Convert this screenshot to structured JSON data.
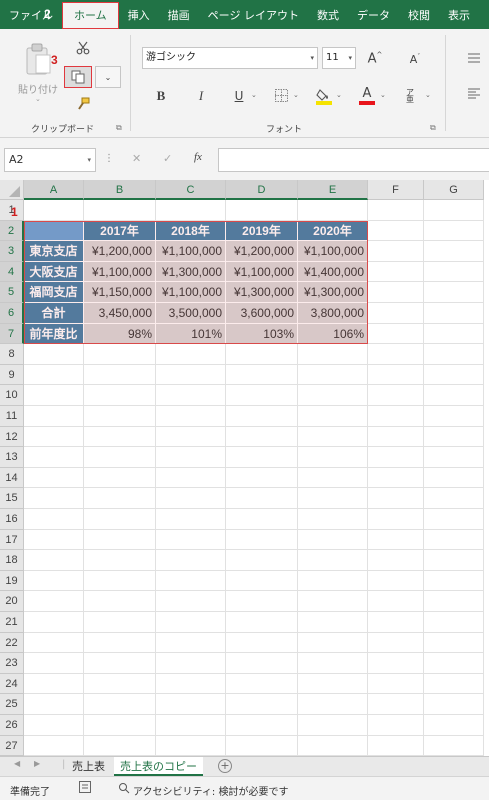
{
  "ribbon_tabs": [
    "ファイル",
    "ホーム",
    "挿入",
    "描画",
    "ページ レイアウト",
    "数式",
    "データ",
    "校閲",
    "表示"
  ],
  "clipboard": {
    "paste_label": "貼り付け",
    "group_label": "クリップボード"
  },
  "font": {
    "name": "游ゴシック",
    "size": "11",
    "group_label": "フォント",
    "bold": "B",
    "italic": "I",
    "underline": "U",
    "color_letter": "A"
  },
  "callouts": {
    "one": "1",
    "two": "2",
    "three": "3"
  },
  "formula_bar": {
    "name_box": "A2",
    "fx": "fx",
    "cancel": "✕",
    "enter": "✓"
  },
  "columns": [
    "A",
    "B",
    "C",
    "D",
    "E",
    "F",
    "G"
  ],
  "rows": [
    "1",
    "2",
    "3",
    "4",
    "5",
    "6",
    "7",
    "8",
    "9",
    "10",
    "11",
    "12",
    "13",
    "14",
    "15",
    "16",
    "17",
    "18",
    "19",
    "20",
    "21",
    "22",
    "23",
    "24",
    "25",
    "26",
    "27"
  ],
  "table": {
    "header": [
      "",
      "2017年",
      "2018年",
      "2019年",
      "2020年"
    ],
    "body": [
      [
        "東京支店",
        "¥1,200,000",
        "¥1,100,000",
        "¥1,200,000",
        "¥1,100,000"
      ],
      [
        "大阪支店",
        "¥1,100,000",
        "¥1,300,000",
        "¥1,100,000",
        "¥1,400,000"
      ],
      [
        "福岡支店",
        "¥1,150,000",
        "¥1,100,000",
        "¥1,300,000",
        "¥1,300,000"
      ],
      [
        "合計",
        "3,450,000",
        "3,500,000",
        "3,600,000",
        "3,800,000"
      ],
      [
        "前年度比",
        "98%",
        "101%",
        "103%",
        "106%"
      ]
    ]
  },
  "sheets": [
    "売上表",
    "売上表のコピー"
  ],
  "status": {
    "ready": "準備完了",
    "accessibility": "アクセシビリティ: 検討が必要です"
  },
  "colors": {
    "excel_green": "#217346",
    "table_header": "#31749f",
    "highlight_red": "#e0383e"
  }
}
